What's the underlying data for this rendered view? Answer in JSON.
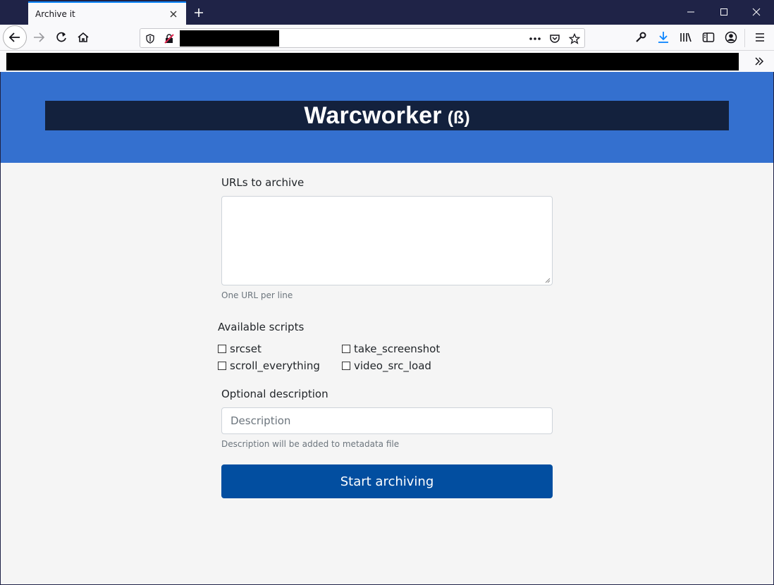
{
  "browser": {
    "tab": {
      "title": "Archive it"
    }
  },
  "page": {
    "title": "Warcworker",
    "title_badge": "(ß)",
    "urls": {
      "label": "URLs to archive",
      "value": "",
      "hint": "One URL per line"
    },
    "scripts": {
      "label": "Available scripts",
      "items": [
        {
          "label": "srcset",
          "checked": false
        },
        {
          "label": "take_screenshot",
          "checked": false
        },
        {
          "label": "scroll_everything",
          "checked": false
        },
        {
          "label": "video_src_load",
          "checked": false
        }
      ]
    },
    "description": {
      "label": "Optional description",
      "placeholder": "Description",
      "value": "",
      "hint": "Description will be added to metadata file"
    },
    "submit_label": "Start archiving"
  },
  "colors": {
    "hero_background": "#3470cf",
    "title_bar": "#13213d",
    "button": "#024ea0",
    "page_background": "#f5f5f5",
    "browser_frame": "#1f2347"
  },
  "icons": {
    "tab_close": "close-icon",
    "new_tab": "plus-icon",
    "window": [
      "minimize-icon",
      "maximize-icon",
      "close-icon"
    ],
    "nav": [
      "back-arrow-icon",
      "forward-arrow-icon",
      "reload-icon",
      "home-icon"
    ],
    "url": [
      "shield-icon",
      "insecure-lock-icon",
      "more-dots-icon",
      "pocket-icon",
      "star-icon"
    ],
    "toolbar": [
      "wrench-icon",
      "download-icon",
      "library-icon",
      "sidebar-icon",
      "account-icon",
      "hamburger-menu-icon"
    ],
    "bookmarks": [
      "chevron-double-right-icon"
    ]
  }
}
